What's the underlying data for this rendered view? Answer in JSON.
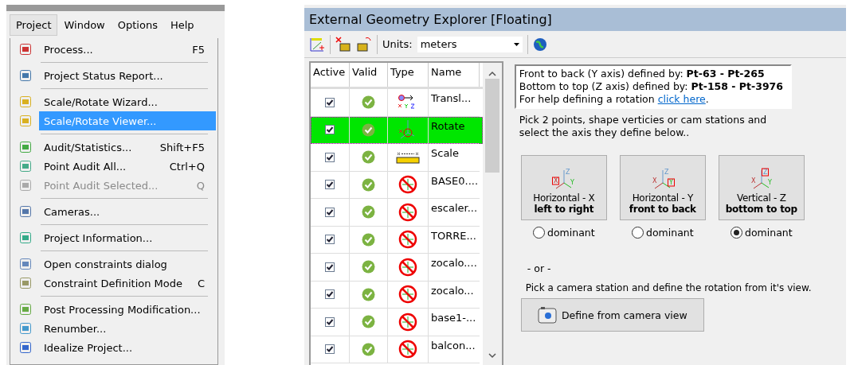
{
  "menu_bar": {
    "items": [
      {
        "label": "Project",
        "selected": true
      },
      {
        "label": "Window",
        "selected": false
      },
      {
        "label": "Options",
        "selected": false
      },
      {
        "label": "Help",
        "selected": false
      }
    ]
  },
  "menu": {
    "items": [
      {
        "kind": "item",
        "label": "Process...",
        "shortcut": "F5",
        "selected": false,
        "disabled": false
      },
      {
        "kind": "separator"
      },
      {
        "kind": "item",
        "label": "Project Status Report...",
        "selected": false,
        "disabled": false
      },
      {
        "kind": "separator"
      },
      {
        "kind": "item",
        "label": "Scale/Rotate Wizard...",
        "selected": false,
        "disabled": false
      },
      {
        "kind": "item",
        "label": "Scale/Rotate Viewer...",
        "selected": true,
        "disabled": false
      },
      {
        "kind": "separator"
      },
      {
        "kind": "item",
        "label": "Audit/Statistics...",
        "shortcut": "Shift+F5",
        "selected": false,
        "disabled": false
      },
      {
        "kind": "item",
        "label": "Point Audit All...",
        "shortcut": "Ctrl+Q",
        "selected": false,
        "disabled": false
      },
      {
        "kind": "item",
        "label": "Point Audit Selected...",
        "shortcut": "Q",
        "selected": false,
        "disabled": true
      },
      {
        "kind": "separator"
      },
      {
        "kind": "item",
        "label": "Cameras...",
        "selected": false,
        "disabled": false
      },
      {
        "kind": "separator"
      },
      {
        "kind": "item",
        "label": "Project Information...",
        "selected": false,
        "disabled": false
      },
      {
        "kind": "separator"
      },
      {
        "kind": "item",
        "label": "Open constraints dialog",
        "selected": false,
        "disabled": false
      },
      {
        "kind": "item",
        "label": "Constraint Definition Mode",
        "shortcut": "C",
        "selected": false,
        "disabled": false
      },
      {
        "kind": "separator"
      },
      {
        "kind": "item",
        "label": "Post Processing Modification...",
        "selected": false,
        "disabled": false
      },
      {
        "kind": "item",
        "label": "Renumber...",
        "selected": false,
        "disabled": false
      },
      {
        "kind": "item",
        "label": "Idealize Project...",
        "selected": false,
        "disabled": false
      }
    ]
  },
  "explorer": {
    "title": "External Geometry Explorer [Floating]",
    "toolbar": {
      "units_label": "Units:",
      "units_value": "meters"
    },
    "table": {
      "columns": [
        "Active",
        "Valid",
        "Type",
        "Name"
      ],
      "rows": [
        {
          "active": true,
          "valid": true,
          "kind": "translate",
          "name": "Transl...",
          "selected": false
        },
        {
          "active": true,
          "valid": true,
          "kind": "rotate",
          "name": "Rotate",
          "selected": true
        },
        {
          "active": true,
          "valid": true,
          "kind": "scale",
          "name": "Scale",
          "selected": false
        },
        {
          "active": true,
          "valid": true,
          "kind": "constraint",
          "name": "BASE0....",
          "selected": false
        },
        {
          "active": true,
          "valid": true,
          "kind": "constraint",
          "name": "escaler...",
          "selected": false
        },
        {
          "active": true,
          "valid": true,
          "kind": "constraint",
          "name": "TORRE...",
          "selected": false
        },
        {
          "active": true,
          "valid": true,
          "kind": "constraint",
          "name": "zocalo....",
          "selected": false
        },
        {
          "active": true,
          "valid": true,
          "kind": "constraint",
          "name": "zocalo...",
          "selected": false
        },
        {
          "active": true,
          "valid": true,
          "kind": "constraint",
          "name": "base1-...",
          "selected": false
        },
        {
          "active": true,
          "valid": true,
          "kind": "constraint",
          "name": "balcon...",
          "selected": false
        }
      ]
    },
    "info": {
      "lines": [
        "Front to back (Y axis) defined by:  **Pt-63 -  Pt-265**",
        "Bottom to top (Z axis) defined by:  **Pt-158 -  Pt-3976**"
      ],
      "help_text": "For help defining a rotation",
      "help_link": "click here",
      "help_end": "."
    },
    "instructions": "Pick 2 points, shape verticies or cam stations and select the axis they define below..",
    "axes": [
      {
        "kind": "x",
        "icon_letters": [
          "Z",
          "X",
          "Y"
        ],
        "title": "Horizontal - X",
        "subtitle": "left to right",
        "option": "dominant",
        "selected": false
      },
      {
        "kind": "y",
        "icon_letters": [
          "Z",
          "X",
          "Y"
        ],
        "title": "Horizontal - Y",
        "subtitle": "front to back",
        "option": "dominant",
        "selected": false
      },
      {
        "kind": "z",
        "icon_letters": [
          "Z",
          "X",
          "Y"
        ],
        "title": "Vertical - Z",
        "subtitle": "bottom to top",
        "option": "dominant",
        "selected": true
      }
    ],
    "or_text": "- or -",
    "camera_text": "Pick a camera station and define the rotation from it's view.",
    "camera_button": "Define from camera view"
  }
}
